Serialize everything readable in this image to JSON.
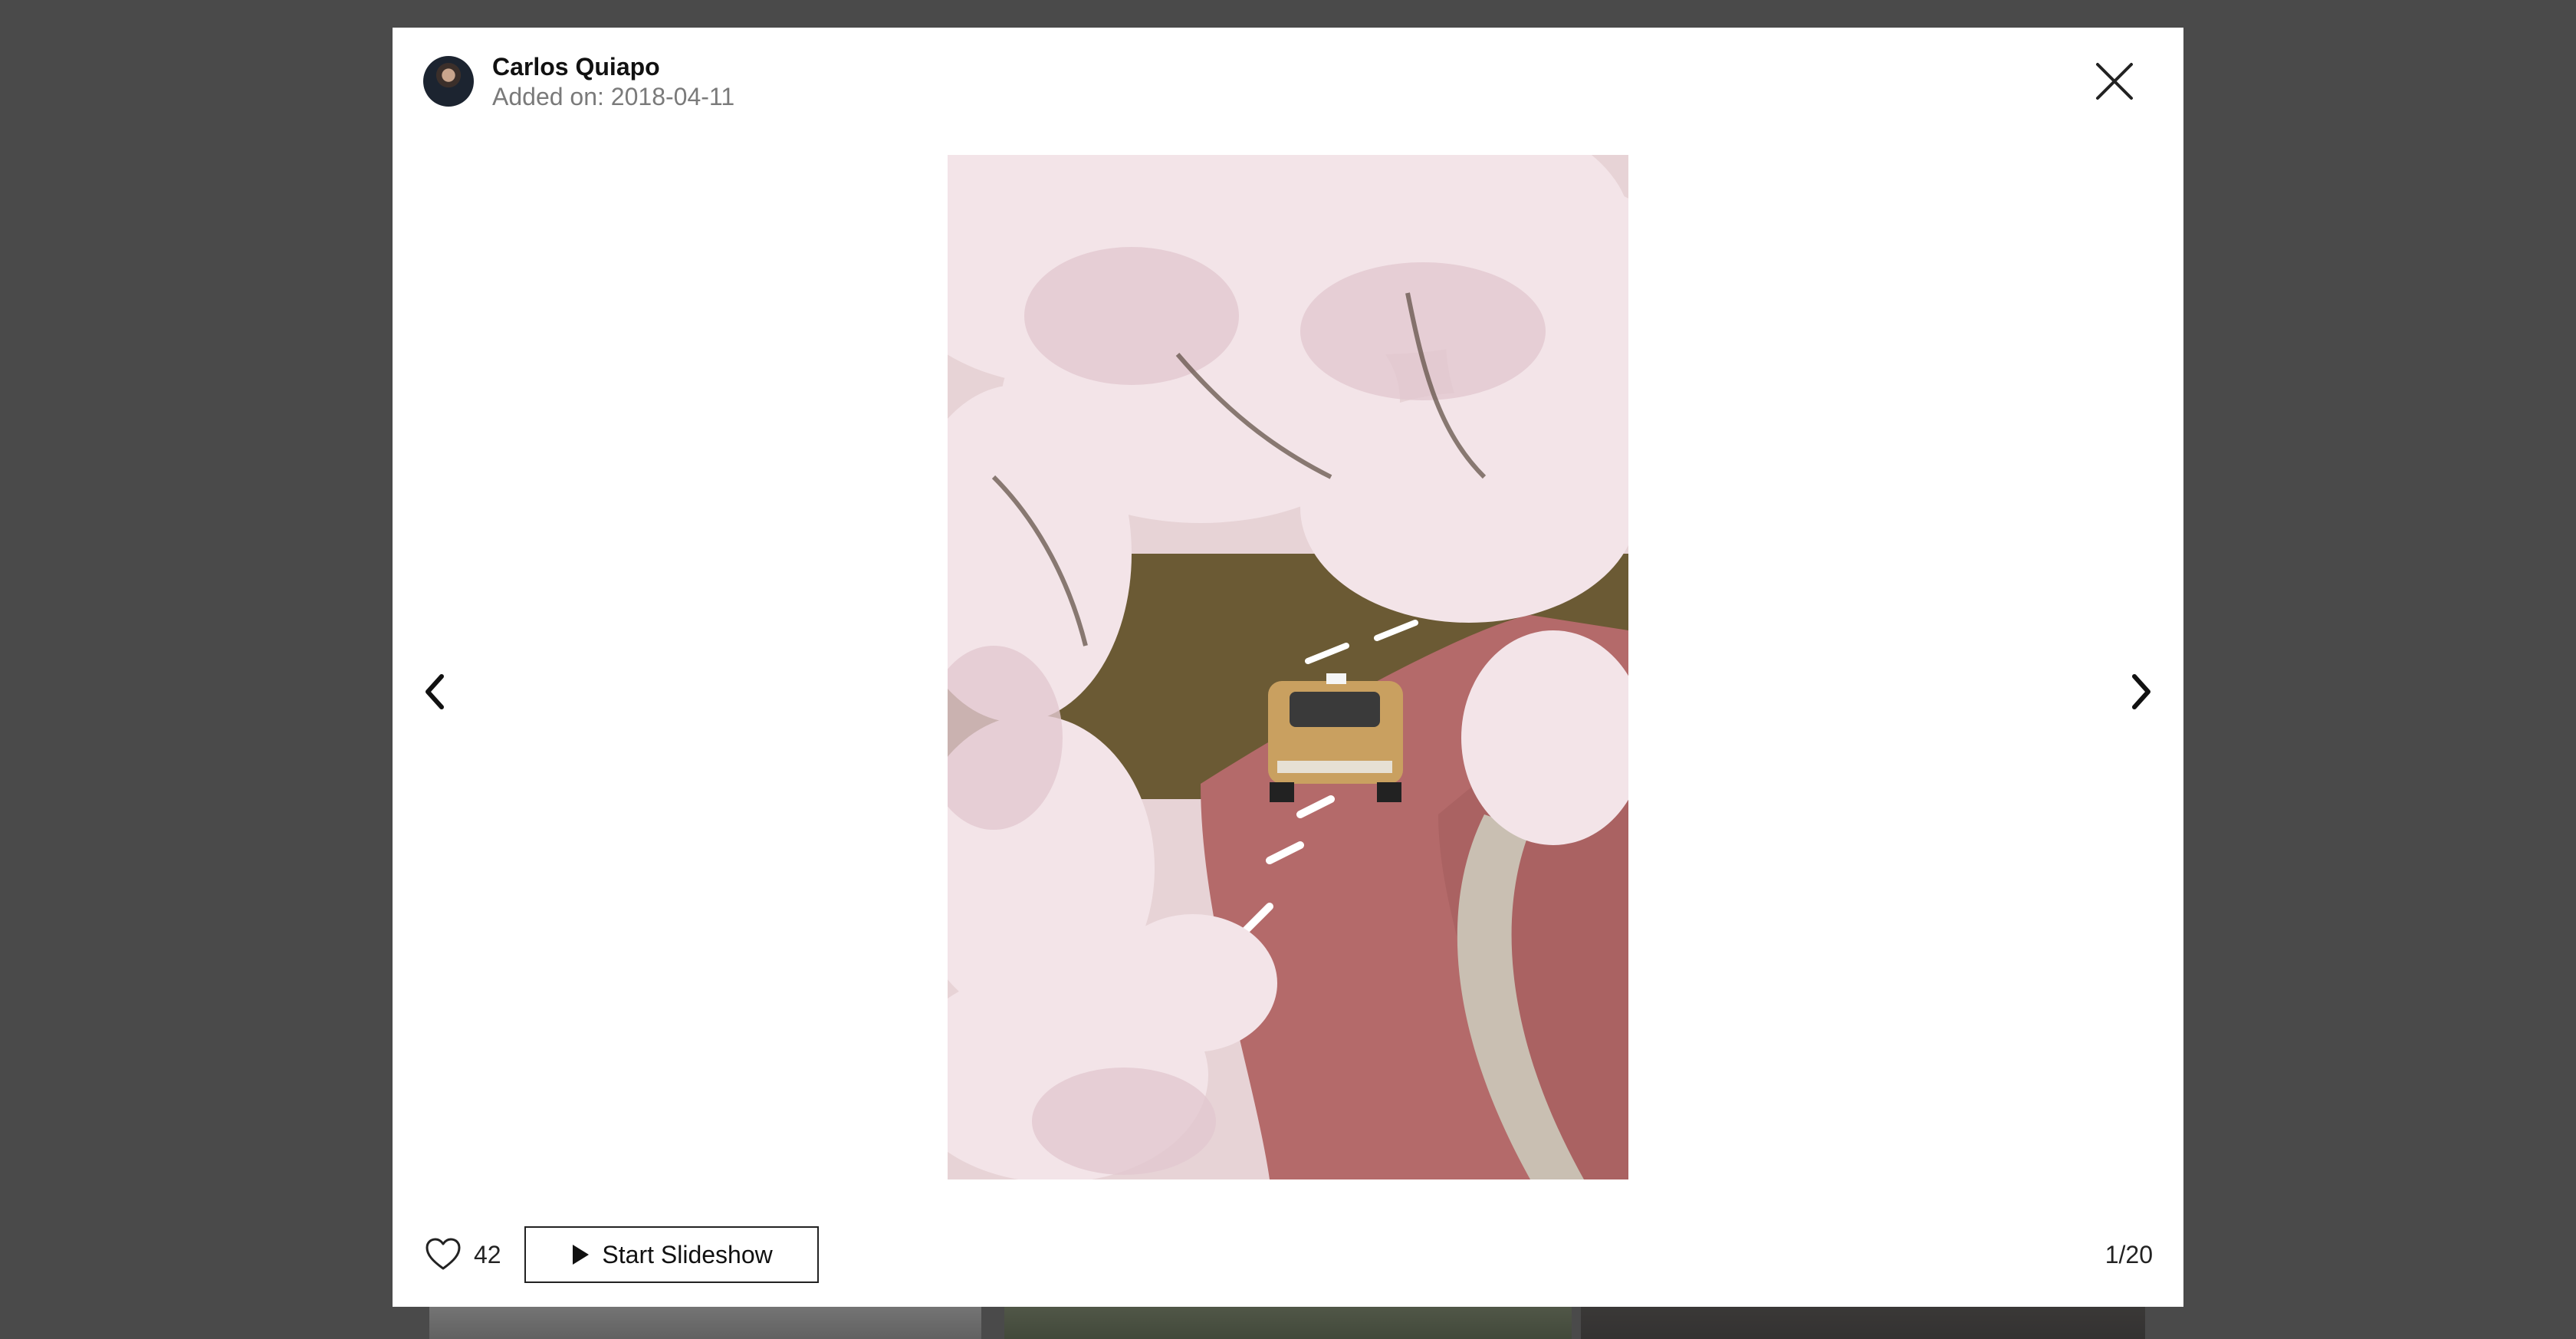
{
  "modal": {
    "author": {
      "name": "Carlos Quiapo",
      "added_on": "Added on: 2018-04-11"
    },
    "photo": {
      "alt": "Taxi driving on a curved road under cherry blossoms"
    },
    "footer": {
      "likes": "42",
      "slideshow_label": "Start Slideshow",
      "counter": "1/20"
    },
    "icons": {
      "close": "close-icon",
      "prev": "chevron-left-icon",
      "next": "chevron-right-icon",
      "like": "heart-icon",
      "play": "play-icon"
    }
  },
  "colors": {
    "overlay": "#5b5b5b",
    "modal_bg": "#ffffff",
    "road": "#b46a6a",
    "blossom": "#f1dfe3",
    "taxi": "#c9a060"
  }
}
